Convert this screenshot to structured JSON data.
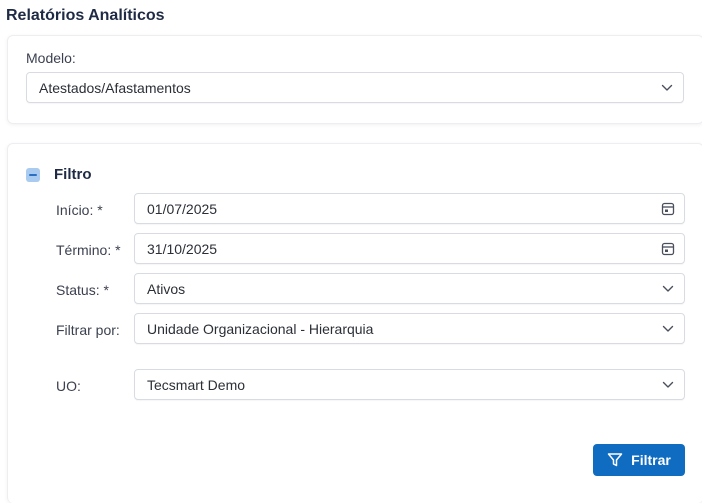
{
  "page": {
    "title": "Relatórios Analíticos"
  },
  "model": {
    "label": "Modelo:",
    "value": "Atestados/Afastamentos",
    "icon": "chevron-down-icon"
  },
  "filter": {
    "title": "Filtro",
    "collapse_icon": "collapse-minus-icon",
    "fields": {
      "inicio": {
        "label": "Início: *",
        "value": "01/07/2025",
        "icon": "calendar-icon"
      },
      "termino": {
        "label": "Término: *",
        "value": "31/10/2025",
        "icon": "calendar-icon"
      },
      "status": {
        "label": "Status: *",
        "value": "Ativos",
        "icon": "chevron-down-icon"
      },
      "filtrar_por": {
        "label": "Filtrar por:",
        "value": "Unidade Organizacional - Hierarquia",
        "icon": "chevron-down-icon"
      },
      "uo": {
        "label": "UO:",
        "value": "Tecsmart Demo",
        "icon": "chevron-down-icon"
      }
    },
    "submit": {
      "label": "Filtrar",
      "icon": "funnel-icon"
    }
  },
  "colors": {
    "accent": "#0f6cc0",
    "collapse": "#a9cbf0"
  }
}
